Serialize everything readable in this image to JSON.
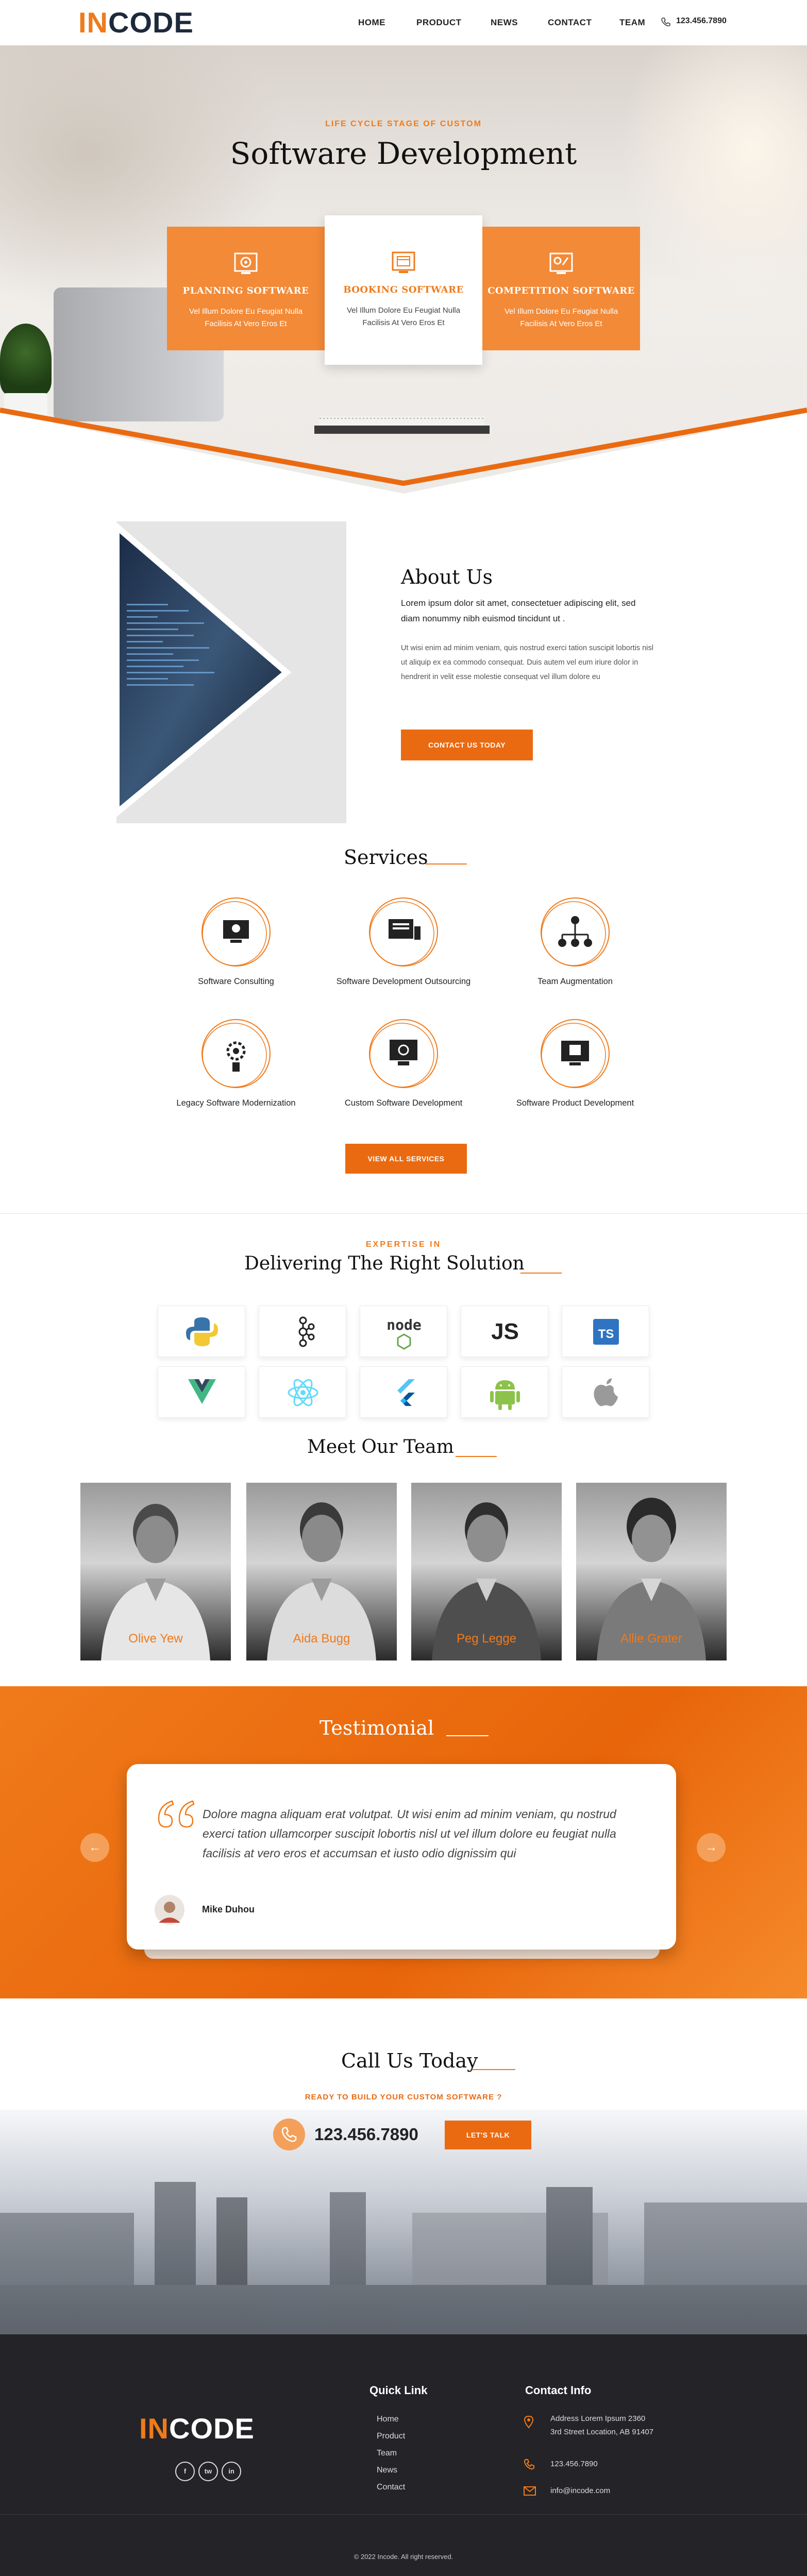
{
  "brand": {
    "logo_in": "IN",
    "logo_code": "CODE",
    "accent": "#f07a1a",
    "dark": "#242428"
  },
  "nav": {
    "items": [
      "HOME",
      "PRODUCT",
      "NEWS",
      "CONTACT",
      "TEAM"
    ],
    "phone": "123.456.7890",
    "phone_icon": "phone-icon"
  },
  "hero": {
    "subtitle": "LIFE CYCLE STAGE OF CUSTOM",
    "title": "Software Development",
    "cards": [
      {
        "title": "PLANNING SOFTWARE",
        "desc": "Vel Illum Dolore Eu Feugiat Nulla Facilisis At Vero Eros Et",
        "icon": "target-screen-icon"
      },
      {
        "title": "BOOKING SOFTWARE",
        "desc": "Vel Illum Dolore Eu Feugiat Nulla Facilisis At Vero Eros Et",
        "icon": "calendar-screen-icon"
      },
      {
        "title": "COMPETITION SOFTWARE",
        "desc": "Vel Illum Dolore Eu Feugiat Nulla Facilisis At Vero Eros Et",
        "icon": "competition-screen-icon"
      }
    ]
  },
  "about": {
    "title": "About Us",
    "lead": "Lorem ipsum dolor sit amet, consectetuer adipiscing elit, sed diam nonummy nibh euismod tincidunt ut .",
    "body": "Ut wisi enim ad minim veniam, quis nostrud exerci tation suscipit lobortis nisl ut aliquip ex ea commodo consequat. Duis autem vel eum iriure dolor in hendrerit in velit esse molestie consequat vel illum dolore eu",
    "button": "CONTACT US TODAY"
  },
  "services": {
    "title": "Services",
    "items": [
      {
        "label": "Software Consulting",
        "icon": "consulting-icon"
      },
      {
        "label": "Software Development Outsourcing",
        "icon": "outsourcing-icon"
      },
      {
        "label": "Team Augmentation",
        "icon": "team-hierarchy-icon"
      },
      {
        "label": "Legacy Software Modernization",
        "icon": "modernization-icon"
      },
      {
        "label": "Custom Software Development",
        "icon": "custom-code-icon"
      },
      {
        "label": "Software Product Development",
        "icon": "product-icon"
      }
    ],
    "button": "VIEW ALL SERVICES"
  },
  "expertise": {
    "kicker": "EXPERTISE IN",
    "title": "Delivering The Right Solution",
    "tech": [
      "python-logo",
      "kafka-logo",
      "node-logo",
      "js-logo",
      "typescript-logo",
      "vue-logo",
      "react-logo",
      "flutter-logo",
      "android-logo",
      "apple-logo"
    ],
    "node_text": "node",
    "js_text": "JS",
    "ts_text": "TS"
  },
  "team": {
    "title": "Meet Our Team",
    "members": [
      "Olive Yew",
      "Aida Bugg",
      "Peg Legge",
      "Allie Grater"
    ]
  },
  "testimonial": {
    "title": "Testimonial",
    "quote": "Dolore magna aliquam erat volutpat. Ut wisi enim ad minim veniam, qu nostrud exerci tation ullamcorper suscipit lobortis nisl ut  vel illum dolore eu feugiat nulla facilisis at vero eros et accumsan et iusto odio dignissim qui",
    "author": "Mike Duhou"
  },
  "call": {
    "title": "Call Us Today",
    "subtitle": "READY TO BUILD YOUR CUSTOM SOFTWARE ?",
    "phone": "123.456.7890",
    "button": "LET'S TALK"
  },
  "footer": {
    "quick_title": "Quick Link",
    "links": [
      "Home",
      "Product",
      "Team",
      "News",
      "Contact"
    ],
    "contact_title": "Contact Info",
    "address_line1": "Address Lorem Ipsum 2360",
    "address_line2": "3rd Street Location, AB 91407",
    "phone": "123.456.7890",
    "email": "info@incode.com",
    "social": [
      "f",
      "tw",
      "in"
    ],
    "copyright": "© 2022 Incode. All right reserved."
  }
}
